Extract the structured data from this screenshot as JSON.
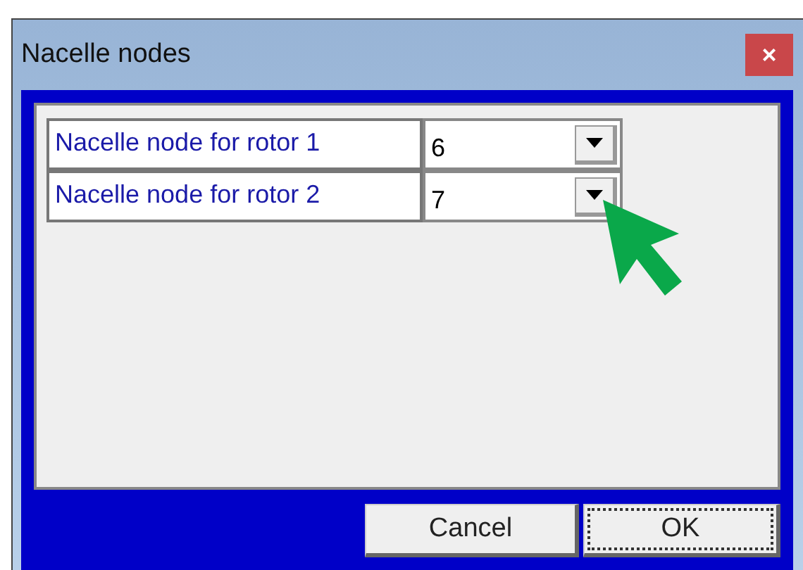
{
  "window": {
    "title": "Nacelle nodes",
    "close": "×"
  },
  "rows": [
    {
      "label": "Nacelle node for rotor 1",
      "value": "6"
    },
    {
      "label": "Nacelle node for rotor 2",
      "value": "7"
    }
  ],
  "buttons": [
    {
      "label": "Cancel",
      "focused": false
    },
    {
      "label": "OK",
      "focused": true
    }
  ]
}
